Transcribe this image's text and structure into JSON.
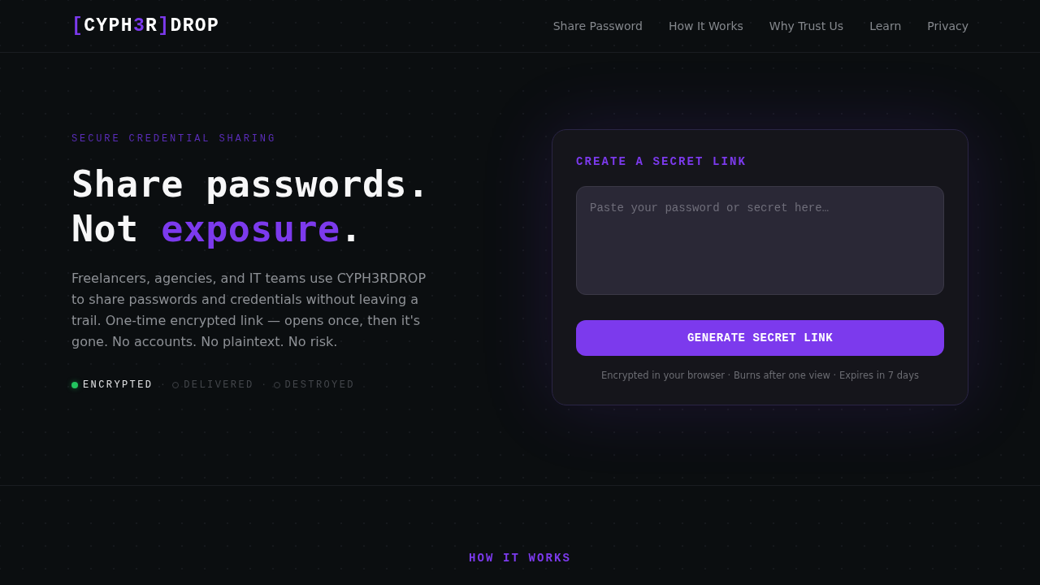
{
  "header": {
    "logo": [
      {
        "text": "[",
        "accent": true
      },
      {
        "text": "CYPH",
        "accent": false
      },
      {
        "text": "3",
        "accent": true
      },
      {
        "text": "R",
        "accent": false
      },
      {
        "text": "]",
        "accent": true
      },
      {
        "text": "DROP",
        "accent": false
      }
    ],
    "nav": [
      "Share Password",
      "How It Works",
      "Why Trust Us",
      "Learn",
      "Privacy"
    ]
  },
  "hero": {
    "eyebrow": "SECURE CREDENTIAL SHARING",
    "headline": [
      [
        {
          "text": "Share passwords.",
          "accent": false
        }
      ],
      [
        {
          "text": "Not ",
          "accent": false
        },
        {
          "text": "exposure",
          "accent": true
        },
        {
          "text": ".",
          "accent": false
        }
      ]
    ],
    "description": "Freelancers, agencies, and IT teams use CYPH3RDROP to share passwords and credentials without leaving a trail. One-time encrypted link — opens once, then it's gone. No accounts. No plaintext. No risk.",
    "steps": [
      {
        "kind": "step",
        "label": "ENCRYPTED",
        "active": true
      },
      {
        "kind": "separator",
        "text": "·"
      },
      {
        "kind": "step",
        "label": "DELIVERED",
        "active": false
      },
      {
        "kind": "separator",
        "text": "·"
      },
      {
        "kind": "step",
        "label": "DESTROYED",
        "active": false
      }
    ]
  },
  "card": {
    "title": "CREATE A SECRET LINK",
    "secret_field": {
      "placeholder": "Paste your password or secret here…"
    },
    "button": "GENERATE SECRET LINK",
    "footnote": "Encrypted in your browser · Burns after one view · Expires in 7 days"
  },
  "next_section": {
    "eyebrow": "HOW IT WORKS"
  }
}
